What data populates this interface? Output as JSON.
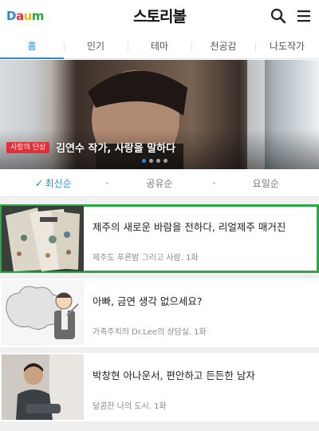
{
  "header": {
    "logo_parts": [
      "D",
      "a",
      "u",
      "m"
    ],
    "logo_colors": [
      "#2d87d3",
      "#e0303a",
      "#f2b319",
      "#2aa844"
    ],
    "title": "스토리볼",
    "search_icon": "search-icon",
    "menu_icon": "hamburger-menu-icon"
  },
  "tabs": [
    {
      "label": "홈",
      "active": true
    },
    {
      "label": "인기"
    },
    {
      "label": "테마"
    },
    {
      "label": "천공감"
    },
    {
      "label": "나도작가"
    }
  ],
  "banner": {
    "tag": "사랑의 단상",
    "caption": "김연수 작가, 사랑을 말하다",
    "slide_count": 4,
    "active_slide": 1
  },
  "sort": [
    {
      "label": "최신순",
      "active": true,
      "icon": "check-icon"
    },
    {
      "label": "공유순"
    },
    {
      "label": "요일순"
    }
  ],
  "items": [
    {
      "title": "제주의 새로운 바람을 전하다, 리얼제주 매거진",
      "meta": "제주도 푸른밤 그리고 사람. 1화",
      "highlight": true
    },
    {
      "title": "아빠, 금연 생각 없으세요?",
      "meta": "가족주치의 Dr.Lee의 상담실. 1화"
    },
    {
      "title": "박창현 아나운서, 편안하고 든든한 남자",
      "meta": "달콤한 나의 도시. 1화"
    }
  ]
}
